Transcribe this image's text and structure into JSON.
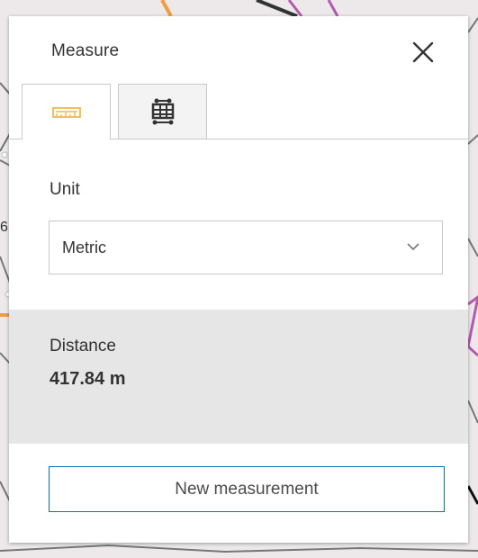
{
  "widget": {
    "title": "Measure",
    "close_icon": "close-icon",
    "accent_color": "#0079c1",
    "tabs": [
      {
        "name": "distance",
        "icon": "ruler-icon",
        "active": true,
        "icon_color": "#f0c05a"
      },
      {
        "name": "area",
        "icon": "area-measure-icon",
        "active": false
      }
    ]
  },
  "unit": {
    "label": "Unit",
    "selected": "Metric",
    "dropdown_icon": "chevron-down-icon"
  },
  "result": {
    "label": "Distance",
    "value": "417.84 m"
  },
  "actions": {
    "new_measurement": "New measurement"
  },
  "map": {
    "visible_text": [
      "6"
    ],
    "road_color": "#f39c3a",
    "boundary_color": "#b45ab0"
  }
}
